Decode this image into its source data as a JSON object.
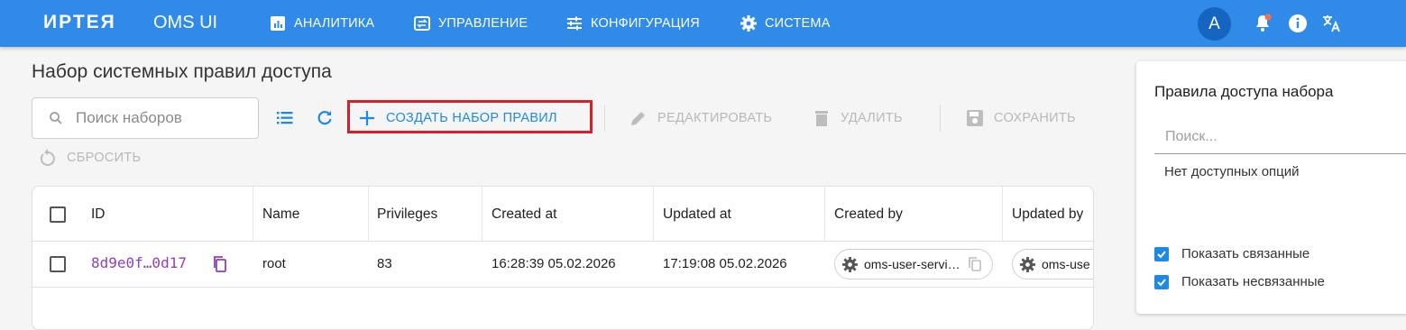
{
  "header": {
    "brand": "ИРТЕЯ",
    "app_name": "OMS UI",
    "nav": [
      {
        "label": "АНАЛИТИКА",
        "icon": "chart-icon"
      },
      {
        "label": "УПРАВЛЕНИЕ",
        "icon": "swap-icon"
      },
      {
        "label": "КОНФИГУРАЦИЯ",
        "icon": "sliders-icon"
      },
      {
        "label": "СИСТЕМА",
        "icon": "gear-icon"
      }
    ],
    "avatar_letter": "A",
    "icons": [
      "bell-icon",
      "info-icon",
      "translate-icon"
    ],
    "notification_dot_color": "#ff7043"
  },
  "main": {
    "title": "Набор системных правил доступа",
    "search_placeholder": "Поиск наборов",
    "toolbar": {
      "create": "СОЗДАТЬ НАБОР ПРАВИЛ",
      "edit": "РЕДАКТИРОВАТЬ",
      "delete": "УДАЛИТЬ",
      "save": "СОХРАНИТЬ",
      "reset": "СБРОСИТЬ"
    },
    "table": {
      "columns": [
        "ID",
        "Name",
        "Privileges",
        "Created at",
        "Updated at",
        "Created by",
        "Updated by"
      ],
      "rows": [
        {
          "id": "8d9e0f…0d17",
          "name": "root",
          "privileges": "83",
          "created_at": "16:28:39 05.02.2026",
          "updated_at": "17:19:08 05.02.2026",
          "created_by": "oms-user-servi…",
          "updated_by": "oms-use"
        }
      ]
    }
  },
  "side": {
    "title": "Правила доступа набора",
    "search_placeholder": "Поиск...",
    "empty_text": "Нет доступных опций",
    "show_linked": "Показать связанные",
    "show_unlinked": "Показать несвязанные"
  },
  "colors": {
    "header_bg": "#2f8ae8",
    "primary": "#1e88e5",
    "highlight_border": "#d3202b",
    "id_color": "#8e3fbf"
  }
}
